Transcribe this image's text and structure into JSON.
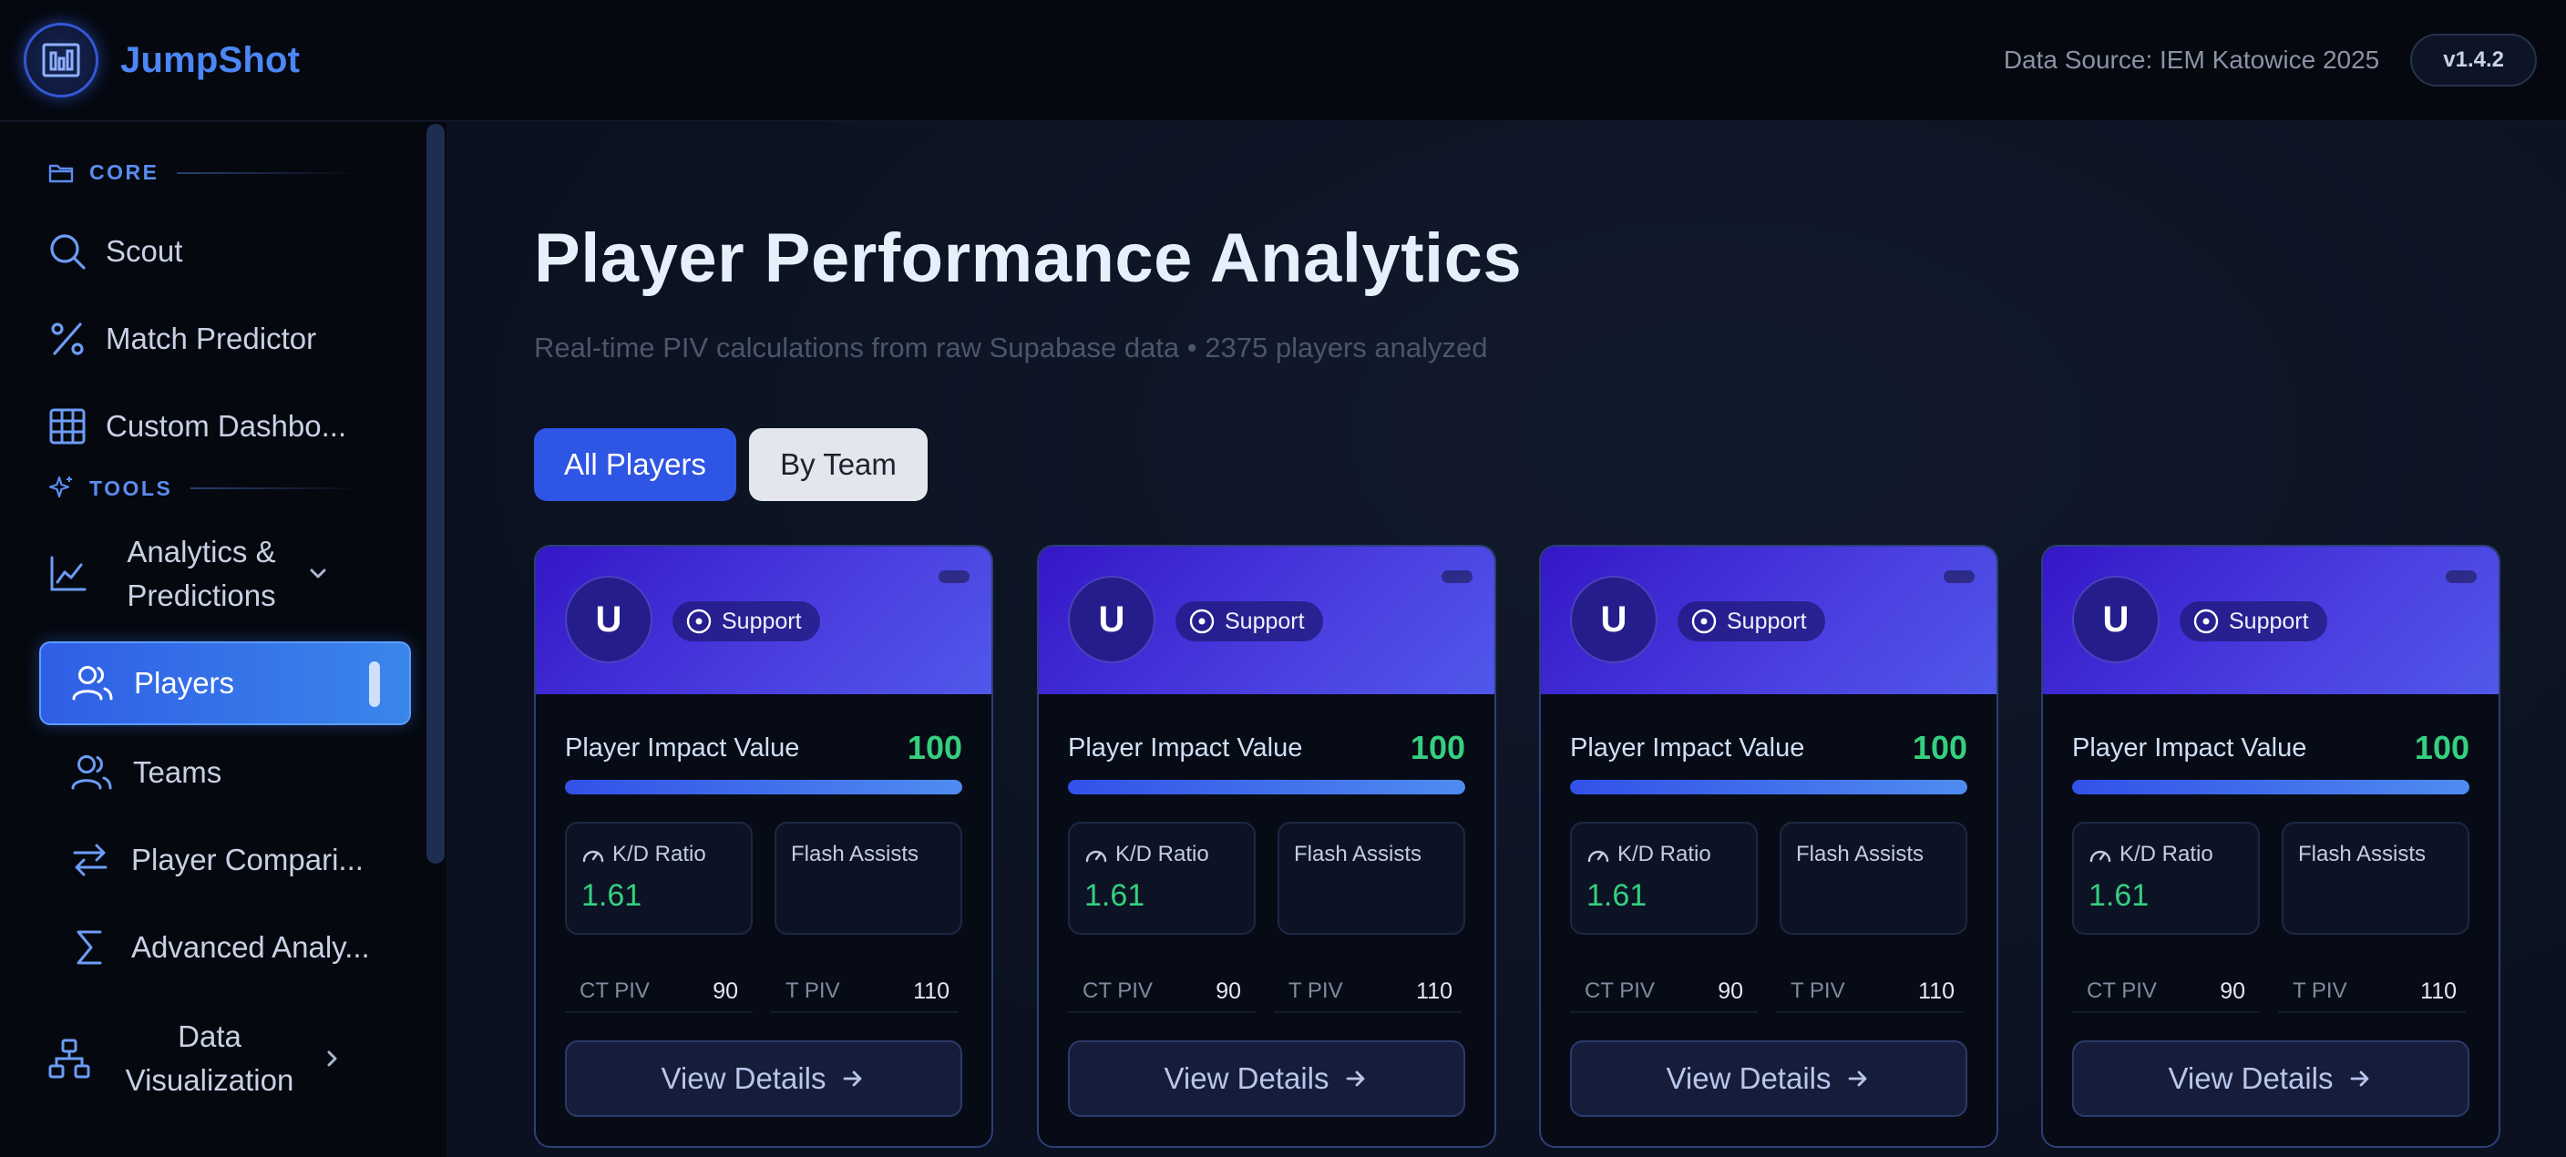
{
  "header": {
    "brand": "JumpShot",
    "data_source": "Data Source: IEM Katowice 2025",
    "version": "v1.4.2"
  },
  "sidebar": {
    "sections": [
      {
        "label": "CORE"
      },
      {
        "label": "TOOLS"
      }
    ],
    "items": [
      {
        "label": "Scout",
        "icon": "search-icon"
      },
      {
        "label": "Match Predictor",
        "icon": "percent-icon"
      },
      {
        "label": "Custom Dashbo...",
        "icon": "grid-icon"
      },
      {
        "label_line1": "Analytics &",
        "label_line2": "Predictions",
        "icon": "chart-line-icon"
      },
      {
        "label": "Players",
        "icon": "users-icon",
        "active": true
      },
      {
        "label": "Teams",
        "icon": "users-icon"
      },
      {
        "label": "Player Compari...",
        "icon": "swap-arrows-icon"
      },
      {
        "label": "Advanced Analy...",
        "icon": "sigma-icon"
      },
      {
        "label_line1": "Data",
        "label_line2": "Visualization",
        "icon": "hierarchy-icon"
      }
    ]
  },
  "main": {
    "title": "Player Performance Analytics",
    "subtitle": "Real-time PIV calculations from raw Supabase data • 2375 players analyzed",
    "tabs": [
      {
        "label": "All Players",
        "active": true
      },
      {
        "label": "By Team",
        "active": false
      }
    ],
    "cards": [
      {
        "initial": "U",
        "role": "Support",
        "piv_label": "Player Impact Value",
        "piv_value": "100",
        "piv_fill": 1.0,
        "kd_label": "K/D Ratio",
        "kd_value": "1.61",
        "flash_label": "Flash Assists",
        "ct_label": "CT PIV",
        "ct_value": "90",
        "t_label": "T PIV",
        "t_value": "110",
        "button": "View Details"
      },
      {
        "initial": "U",
        "role": "Support",
        "piv_label": "Player Impact Value",
        "piv_value": "100",
        "piv_fill": 1.0,
        "kd_label": "K/D Ratio",
        "kd_value": "1.61",
        "flash_label": "Flash Assists",
        "ct_label": "CT PIV",
        "ct_value": "90",
        "t_label": "T PIV",
        "t_value": "110",
        "button": "View Details"
      },
      {
        "initial": "U",
        "role": "Support",
        "piv_label": "Player Impact Value",
        "piv_value": "100",
        "piv_fill": 1.0,
        "kd_label": "K/D Ratio",
        "kd_value": "1.61",
        "flash_label": "Flash Assists",
        "ct_label": "CT PIV",
        "ct_value": "90",
        "t_label": "T PIV",
        "t_value": "110",
        "button": "View Details"
      },
      {
        "initial": "U",
        "role": "Support",
        "piv_label": "Player Impact Value",
        "piv_value": "100",
        "piv_fill": 1.0,
        "kd_label": "K/D Ratio",
        "kd_value": "1.61",
        "flash_label": "Flash Assists",
        "ct_label": "CT PIV",
        "ct_value": "90",
        "t_label": "T PIV",
        "t_value": "110",
        "button": "View Details"
      }
    ]
  },
  "colors": {
    "accent": "#2f55e4",
    "brand": "#4d86f5",
    "positive": "#35d07f",
    "card_header": "#4a3fe0"
  }
}
